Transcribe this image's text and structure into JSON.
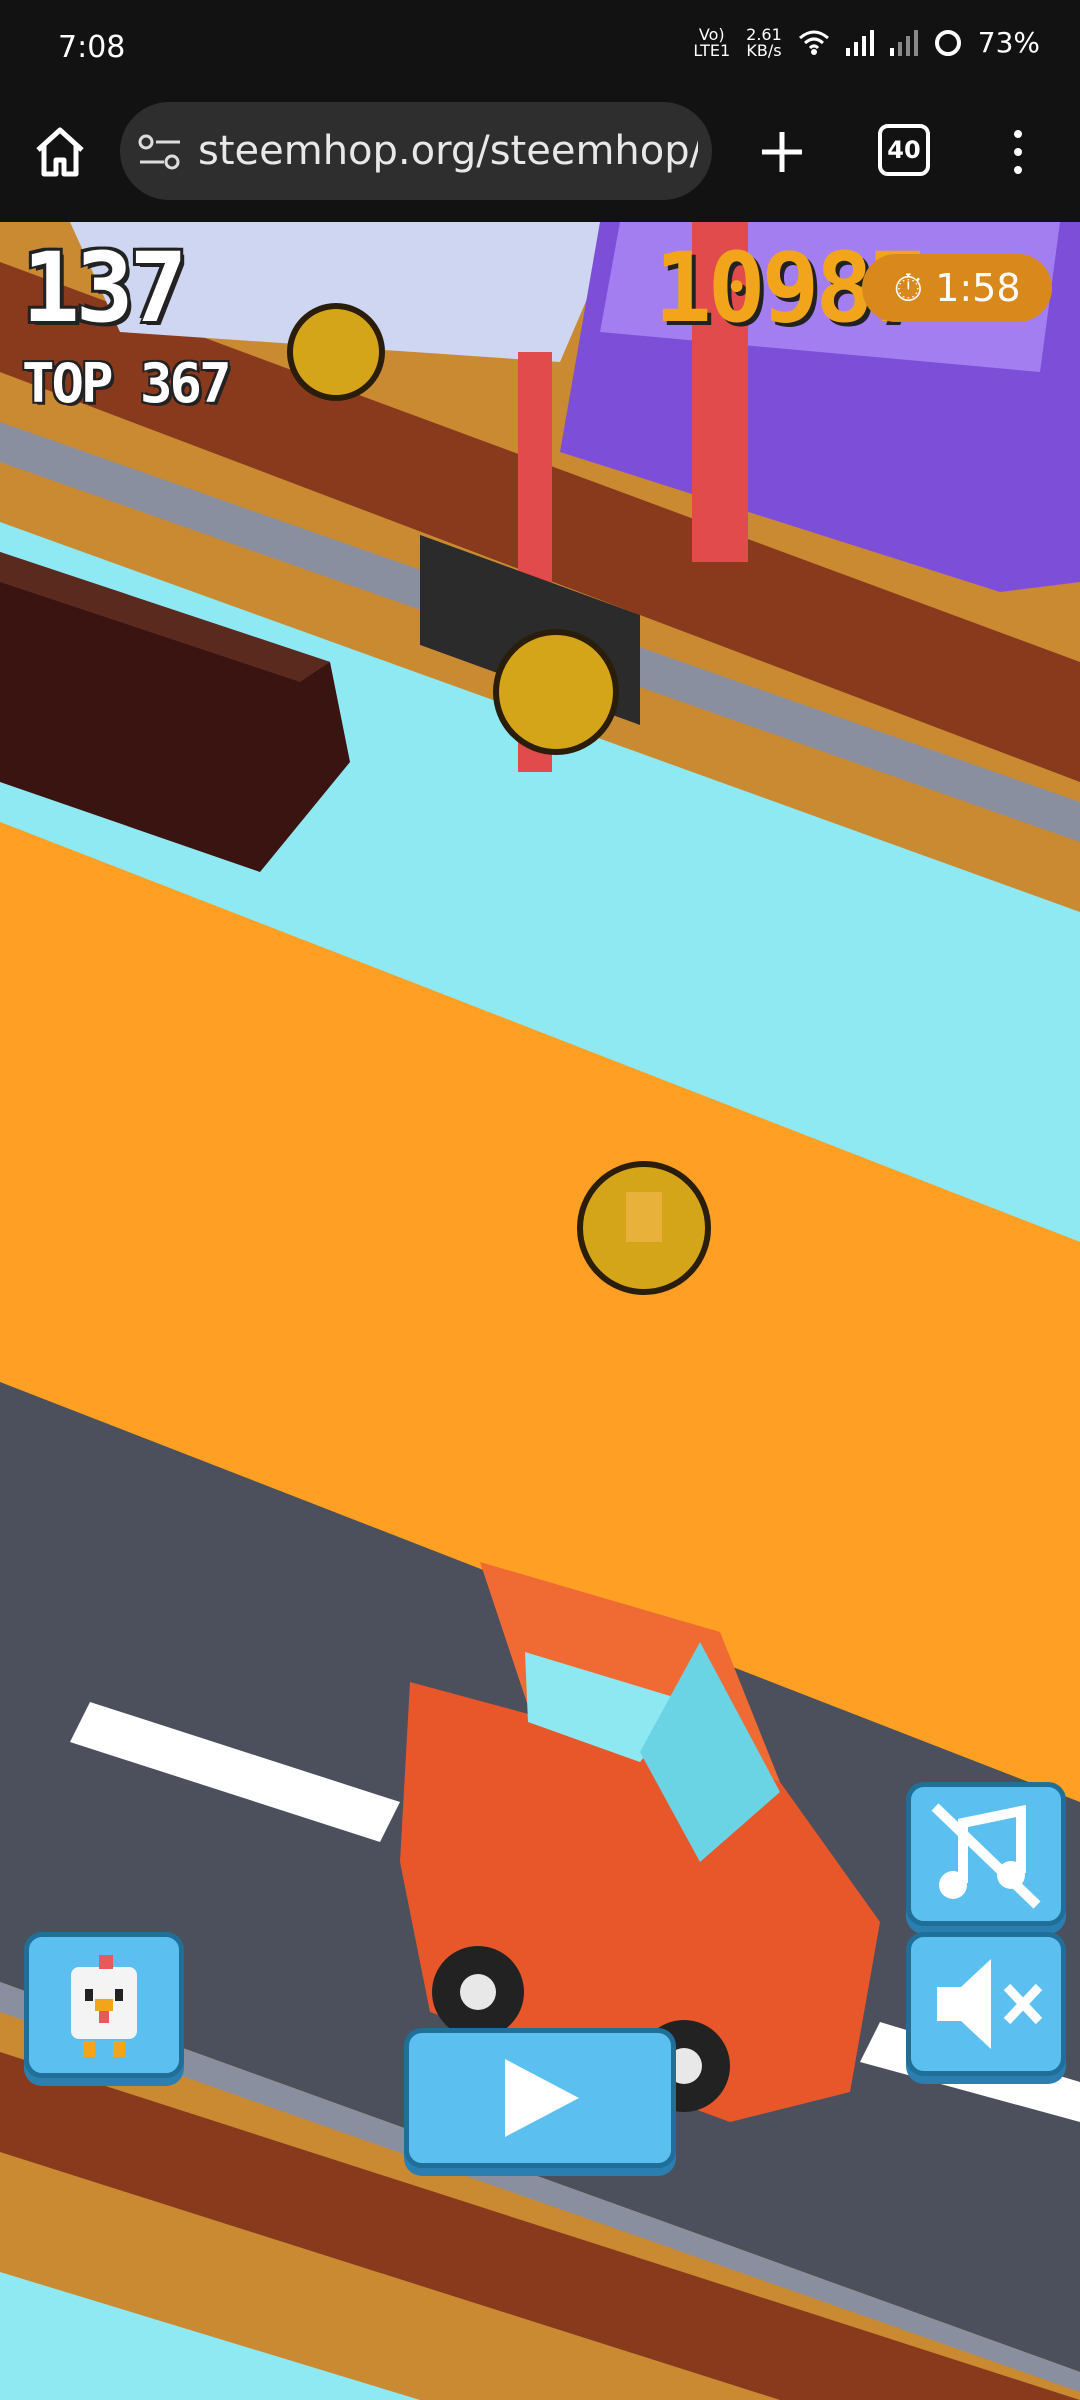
{
  "status_bar": {
    "time": "7:08",
    "network_label_top": "Vo)",
    "network_label_bottom": "LTE1",
    "speed_top": "2.61",
    "speed_bottom": "KB/s",
    "battery": "73%"
  },
  "browser": {
    "url": "steemhop.org/steemhop/inc",
    "tab_count": "40"
  },
  "hud": {
    "score": "137",
    "top_score": "TOP 367",
    "coins": "10987",
    "timer": "1:58"
  },
  "colors": {
    "grass": "#ff9f24",
    "water": "#8fe9f2",
    "road": "#4c4f5c",
    "button": "#5bc0f0"
  },
  "icons": [
    "home-icon",
    "tune-icon",
    "plus-icon",
    "menu-icon",
    "stopwatch-icon",
    "chicken-icon",
    "play-icon",
    "music-off-icon",
    "mute-icon"
  ]
}
